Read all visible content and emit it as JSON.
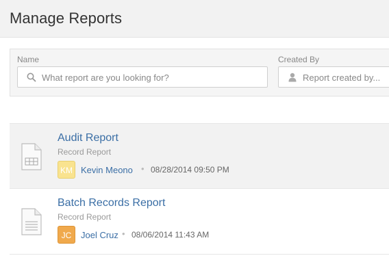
{
  "page": {
    "title": "Manage Reports"
  },
  "filters": {
    "name": {
      "label": "Name",
      "placeholder": "What report are you looking for?",
      "icon": "search-icon"
    },
    "created_by": {
      "label": "Created By",
      "placeholder": "Report created by...",
      "icon": "user-icon"
    }
  },
  "reports": [
    {
      "title": "Audit Report",
      "type": "Record Report",
      "icon": "table-document-icon",
      "author_initials": "KM",
      "author": "Kevin Meono",
      "separator": "•",
      "date": "08/28/2014 09:50 PM",
      "avatar_color": "#f9e38f"
    },
    {
      "title": "Batch Records Report",
      "type": "Record Report",
      "icon": "text-document-icon",
      "author_initials": "JC",
      "author": "Joel Cruz",
      "separator": "•",
      "date": "08/06/2014 11:43 AM",
      "avatar_color": "#f0a94c"
    }
  ],
  "colors": {
    "link": "#3a6ea5",
    "header_bg": "#f2f2f2",
    "selected_row_bg": "#f2f2f2"
  }
}
